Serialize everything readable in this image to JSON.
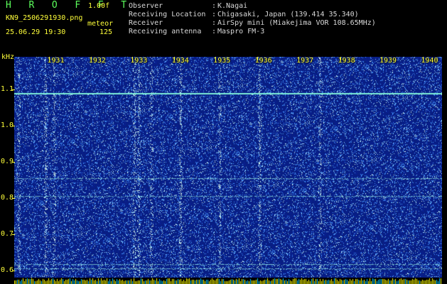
{
  "header": {
    "title": "H R O F F T",
    "version": "1.00f",
    "filename": "KN9_2506291930.png",
    "meteor_label": "meteor",
    "datetime": "25.06.29 19:30",
    "meteor_count": "125"
  },
  "meta": [
    {
      "label": "Observer",
      "value": "K.Nagai"
    },
    {
      "label": "Receiving Location",
      "value": "Chigasaki, Japan (139.414 35.340)"
    },
    {
      "label": "Receiver",
      "value": "AirSpy mini (Miakejima VOR 108.65MHz)"
    },
    {
      "label": "Receiving antenna",
      "value": "Maspro FM-3"
    }
  ],
  "colors": {
    "background": "#000000",
    "axis_text": "#ffff3a",
    "title_text": "#5cff5c",
    "meta_text": "#d8d8d8",
    "spectrum_base": "#0b2a8a",
    "spectrum_noise": "#4fa9ff",
    "echo_line": "#7ff0d8",
    "meteor_tick": "#ffff00",
    "meteor_tick_alt": "#00c8ff"
  },
  "chart_data": {
    "type": "heatmap",
    "ylabel": "kHz",
    "y_ticks": [
      "1.1",
      "1.0",
      "0.9",
      "0.8",
      "0.7",
      "0.6"
    ],
    "y_values": [
      1.1,
      1.0,
      0.9,
      0.8,
      0.7,
      0.6
    ],
    "ylim": [
      0.58,
      1.19
    ],
    "x_ticks": [
      "1931",
      "1932",
      "1933",
      "1934",
      "1935",
      "1936",
      "1937",
      "1938",
      "1939",
      "1940"
    ],
    "x_values": [
      1931,
      1932,
      1933,
      1934,
      1935,
      1936,
      1937,
      1938,
      1939,
      1940
    ],
    "xlim": [
      1930,
      1940.3
    ],
    "horizontal_traces_khz": [
      1.09,
      0.855,
      0.805,
      0.618,
      0.605
    ],
    "vertical_streaks_time": [
      1930.1,
      1930.75,
      1930.95,
      1932.9,
      1933.0,
      1933.3,
      1934.0,
      1934.95,
      1935.9,
      1937.35
    ],
    "meteor_count": 125
  }
}
